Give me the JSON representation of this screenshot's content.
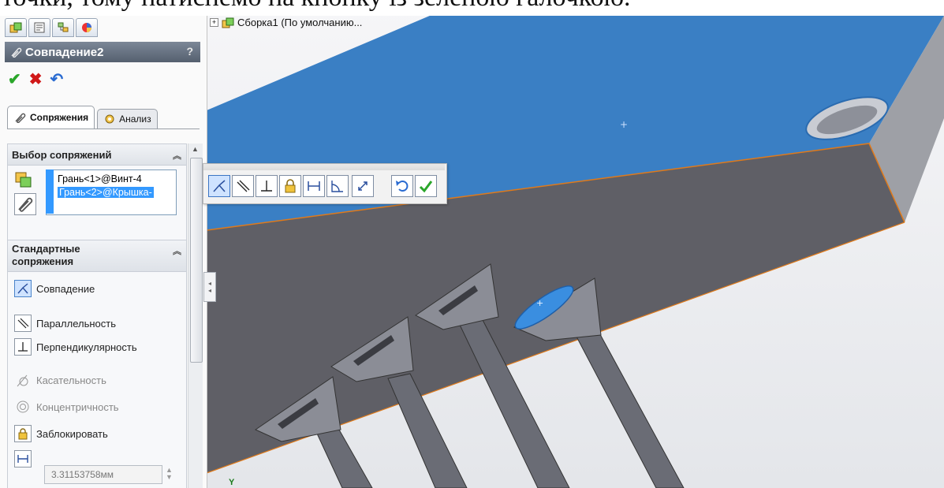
{
  "document": {
    "top_text": "точки, тому натиснемо на кнопку із зеленою галочкою."
  },
  "property_manager": {
    "tab_icons": [
      "assembly-icon",
      "properties-icon",
      "config-icon",
      "appearance-icon"
    ],
    "title": "Совпадение2",
    "help": "?",
    "actions": {
      "ok": "✔",
      "cancel": "✖",
      "undo": "↶"
    },
    "subtabs": {
      "mates": "Сопряжения",
      "analysis": "Анализ"
    },
    "selection": {
      "header": "Выбор сопряжений",
      "items": [
        "Грань<1>@Винт-4",
        "Грань<2>@Крышка-"
      ]
    },
    "standard": {
      "header": "Стандартные сопряжения",
      "mates": {
        "coincident": "Совпадение",
        "parallel": "Параллельность",
        "perpendicular": "Перпендикулярность",
        "tangent": "Касательность",
        "concentric": "Концентричность",
        "lock": "Заблокировать"
      },
      "distance_value": "3.31153758мм"
    }
  },
  "viewport": {
    "tree_label": "Сборка1  (По умолчанию...",
    "axis_label": "Y"
  },
  "colors": {
    "face_blue": "#3a7fc4",
    "face_gray": "#5f5f66",
    "edge_orange": "#e07a1a",
    "accent_green": "#2aa62a",
    "cancel_red": "#d01818"
  }
}
